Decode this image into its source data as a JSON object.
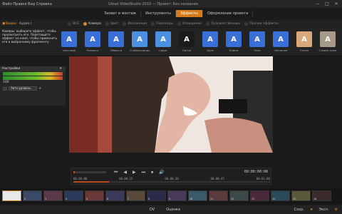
{
  "window": {
    "app_menu": "Файл  Правка  Вид  Справка",
    "title": "Ulead VideoStudio 2010 — Проект: Без названия",
    "minimize": "—",
    "maximize": "□",
    "close": "✕"
  },
  "top_tabs": [
    {
      "label": "Захват и монтаж"
    },
    {
      "label": "Инструменты"
    },
    {
      "label": "Эффекты",
      "active": true
    },
    {
      "label": "Оформление проекта"
    }
  ],
  "filter_bar": {
    "left_items": [
      {
        "label": "Видео",
        "active": true
      },
      {
        "label": "Аудио",
        "active": false
      }
    ],
    "filters": [
      {
        "label": "ВСЕ",
        "active": false
      },
      {
        "label": "Камера",
        "active": true
      },
      {
        "label": "Цвет",
        "active": false
      },
      {
        "label": "Искажение",
        "active": false
      },
      {
        "label": "Переходы",
        "active": false
      },
      {
        "label": "Освещение",
        "active": false
      },
      {
        "label": "Художественные",
        "active": false
      },
      {
        "label": "Прочие эффекты",
        "active": false
      }
    ]
  },
  "effects_strip": {
    "description": "Камеры: выберите эффект, чтобы просмотреть его. Перетащите эффект на клип, чтобы применить его к выбранному фрагменту.",
    "thumbs": [
      {
        "label": "Анаглиф",
        "color": "#3a6fd8"
      },
      {
        "label": "Размыть",
        "color": "#3a6fd8"
      },
      {
        "label": "Обвести",
        "color": "#3a6fd8"
      },
      {
        "label": "Стабилизация",
        "color": "#4a8fe0"
      },
      {
        "label": "Сдвиг",
        "color": "#4a8fe0"
      },
      {
        "label": "Линза",
        "color": "#1b1b1b"
      },
      {
        "label": "Шум",
        "color": "#3a6fd8"
      },
      {
        "label": "Блики",
        "color": "#3a6fd8"
      },
      {
        "label": "Тень",
        "color": "#3a6fd8"
      },
      {
        "label": "Свечение",
        "color": "#3a6fd8"
      },
      {
        "label": "Сепия",
        "color": "#d9a87a"
      },
      {
        "label": "Старое кино",
        "color": "#a89a88"
      },
      {
        "label": "Виньетка",
        "color": "#c98d72"
      }
    ]
  },
  "left_panel": {
    "title": "Настройки",
    "value": "100",
    "select_value": "Авто-уровень"
  },
  "transport": {
    "timecode": "00:00:00:00",
    "marks": [
      "00:00:00",
      "00:00:15",
      "00:00:30",
      "00:00:45",
      "00:01:00"
    ],
    "controls": [
      "⏮",
      "◀",
      "▶",
      "⏭",
      "⏹",
      "🔊"
    ]
  },
  "filmstrip": {
    "clips": [
      "1",
      "2",
      "3",
      "4",
      "5",
      "6",
      "7",
      "8",
      "9",
      "10",
      "11",
      "12",
      "13",
      "14",
      "15",
      "16"
    ]
  },
  "status_bar": {
    "center_items": [
      "DV",
      "Оценка"
    ],
    "right_items": [
      "Сохр.",
      "Эксп."
    ]
  }
}
